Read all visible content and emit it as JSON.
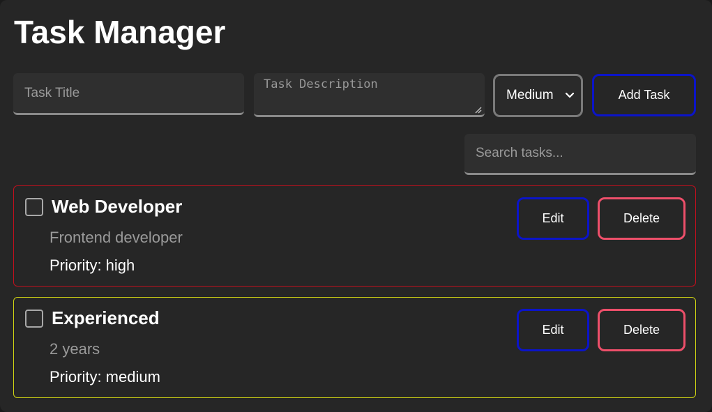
{
  "app": {
    "title": "Task Manager"
  },
  "form": {
    "title_placeholder": "Task Title",
    "title_value": "",
    "description_placeholder": "Task Description",
    "description_value": "",
    "priority_selected": "Medium",
    "add_label": "Add Task"
  },
  "search": {
    "placeholder": "Search tasks...",
    "value": ""
  },
  "tasks": [
    {
      "title": "Web Developer",
      "description": "Frontend developer",
      "priority_text": "Priority: high",
      "border_color": "#c0101e",
      "checked": false,
      "edit_label": "Edit",
      "delete_label": "Delete"
    },
    {
      "title": "Experienced",
      "description": "2 years",
      "priority_text": "Priority: medium",
      "border_color": "#cfd313",
      "checked": false,
      "edit_label": "Edit",
      "delete_label": "Delete"
    }
  ],
  "colors": {
    "edit_border": "#0b14c9",
    "delete_border": "#ee4f6a",
    "background": "#262626"
  },
  "icons": {
    "select_arrow": "chevron-down-icon",
    "checkbox": "checkbox-icon",
    "resize": "resize-grip-icon"
  }
}
